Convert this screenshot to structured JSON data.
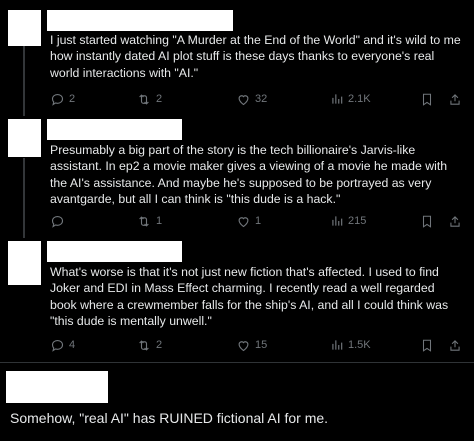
{
  "tweets": [
    {
      "text": "I just started watching \"A Murder at the End of the World\" and it's wild to me how instantly dated AI plot stuff is these days thanks to everyone's real world interactions with \"AI.\"",
      "replies": "2",
      "reposts": "2",
      "likes": "32",
      "views": "2.1K"
    },
    {
      "text": "Presumably a big part of the story is the tech billionaire's Jarvis-like assistant. In ep2 a movie maker gives a viewing of a movie he made with the AI's assistance. And maybe he's supposed to be portrayed as very avantgarde, but all I can think is \"this dude is a hack.\"",
      "replies": "",
      "reposts": "1",
      "likes": "1",
      "views": "215"
    },
    {
      "text": "What's worse is that it's not just new fiction that's affected. I used to find Joker and EDI in Mass Effect charming. I recently read a well regarded book where a crewmember falls for the ship's AI, and all I could think was \"this dude is mentally unwell.\"",
      "replies": "4",
      "reposts": "2",
      "likes": "15",
      "views": "1.5K"
    }
  ],
  "final_comment": "Somehow, \"real AI\" has RUINED fictional AI for me.",
  "colors": {
    "background": "#000000",
    "text": "#e7e9ea",
    "muted": "#71767b",
    "line": "#333639"
  }
}
